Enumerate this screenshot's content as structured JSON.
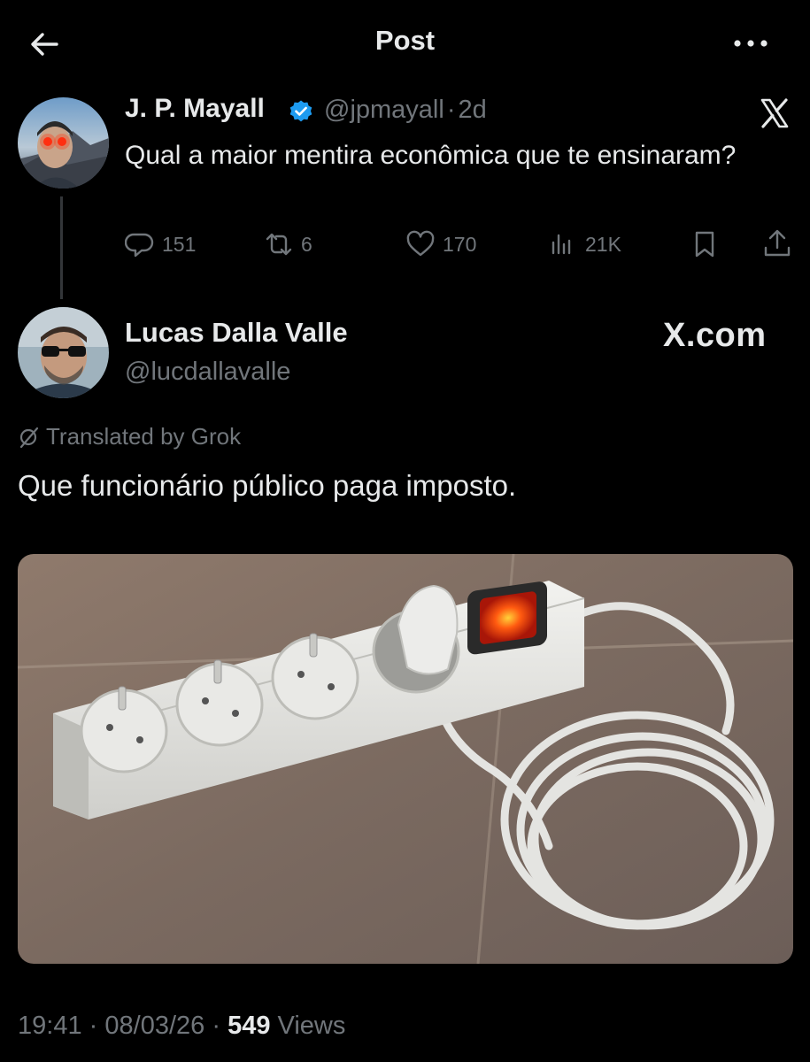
{
  "header": {
    "title": "Post"
  },
  "quoted_post": {
    "author_name": "J. P. Mayall",
    "handle": "@jpmayall",
    "separator": "·",
    "time_ago": "2d",
    "text": "Qual a maior mentira econômica que te ensinaram?",
    "actions": {
      "replies": "151",
      "reposts": "6",
      "likes": "170",
      "views": "21K"
    }
  },
  "reply_post": {
    "author_name": "Lucas Dalla Valle",
    "handle": "@lucdallavalle",
    "site_label": "X.com",
    "translated_label": "Translated by Grok",
    "text": "Que funcionário público paga imposto.",
    "timestamp_time": "19:41",
    "timestamp_date": "08/03/26",
    "separator": "·",
    "views_count": "549",
    "views_label": "Views"
  },
  "colors": {
    "background": "#000000",
    "text_primary": "#e7e9ea",
    "text_secondary": "#71767b",
    "verified_badge": "#1d9bf0"
  }
}
